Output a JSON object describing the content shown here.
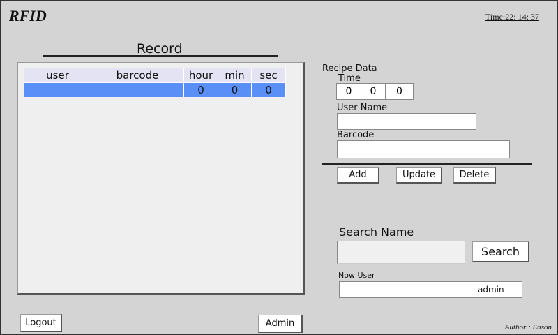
{
  "app": {
    "title": "RFID",
    "clock": "Time:22: 14: 37"
  },
  "record": {
    "title": "Record",
    "columns": [
      "user",
      "barcode",
      "hour",
      "min",
      "sec"
    ],
    "rows": [
      {
        "user": "",
        "barcode": "",
        "hour": "0",
        "min": "0",
        "sec": "0"
      }
    ]
  },
  "recipe": {
    "section_label": "Recipe Data",
    "time_label": "Time",
    "time_values": [
      "0",
      "0",
      "0"
    ],
    "username_label": "User Name",
    "username_value": "",
    "barcode_label": "Barcode",
    "barcode_value": "",
    "add_label": "Add",
    "update_label": "Update",
    "delete_label": "Delete"
  },
  "search": {
    "label": "Search Name",
    "value": "",
    "button_label": "Search",
    "now_user_label": "Now User",
    "now_user_value": "admin"
  },
  "footer": {
    "logout_label": "Logout",
    "admin_label": "Admin",
    "author": "Author : Eason"
  },
  "colors": {
    "background": "#d4d4d4",
    "selected_row": "#5b8ff8",
    "header_row": "#e3e3f3"
  }
}
